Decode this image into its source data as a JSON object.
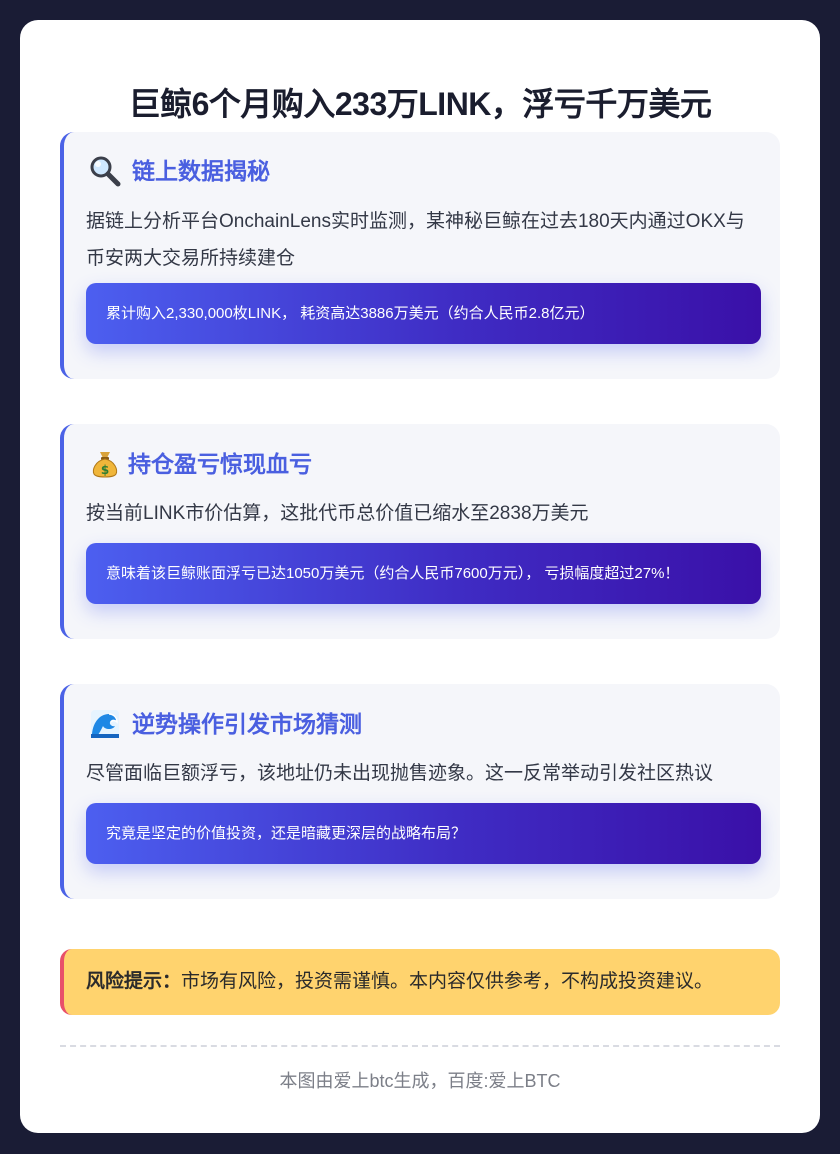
{
  "title": "巨鲸6个月购入233万LINK，浮亏千万美元",
  "sections": [
    {
      "icon": "magnifier-icon",
      "heading": "链上数据揭秘",
      "body": "据链上分析平台OnchainLens实时监测，某神秘巨鲸在过去180天内通过OKX与币安两大交易所持续建仓",
      "highlight": "累计购入2,330,000枚LINK， 耗资高达3886万美元（约合人民币2.8亿元）"
    },
    {
      "icon": "money-bag-icon",
      "heading": "持仓盈亏惊现血亏",
      "body": "按当前LINK市价估算，这批代币总价值已缩水至2838万美元",
      "highlight": "意味着该巨鲸账面浮亏已达1050万美元（约合人民币7600万元）， 亏损幅度超过27%！"
    },
    {
      "icon": "wave-icon",
      "heading": "逆势操作引发市场猜测",
      "body": "尽管面临巨额浮亏，该地址仍未出现抛售迹象。这一反常举动引发社区热议",
      "highlight": "究竟是坚定的价值投资，还是暗藏更深层的战略布局？"
    }
  ],
  "risk": {
    "label": "风险提示：",
    "text": "市场有风险，投资需谨慎。本内容仅供参考，不构成投资建议。"
  },
  "footer": "本图由爱上btc生成，百度:爱上BTC",
  "colors": {
    "background": "#1a1c35",
    "accent": "#4a5fe0",
    "risk_bg": "#ffd36e",
    "risk_border": "#e8506a"
  }
}
